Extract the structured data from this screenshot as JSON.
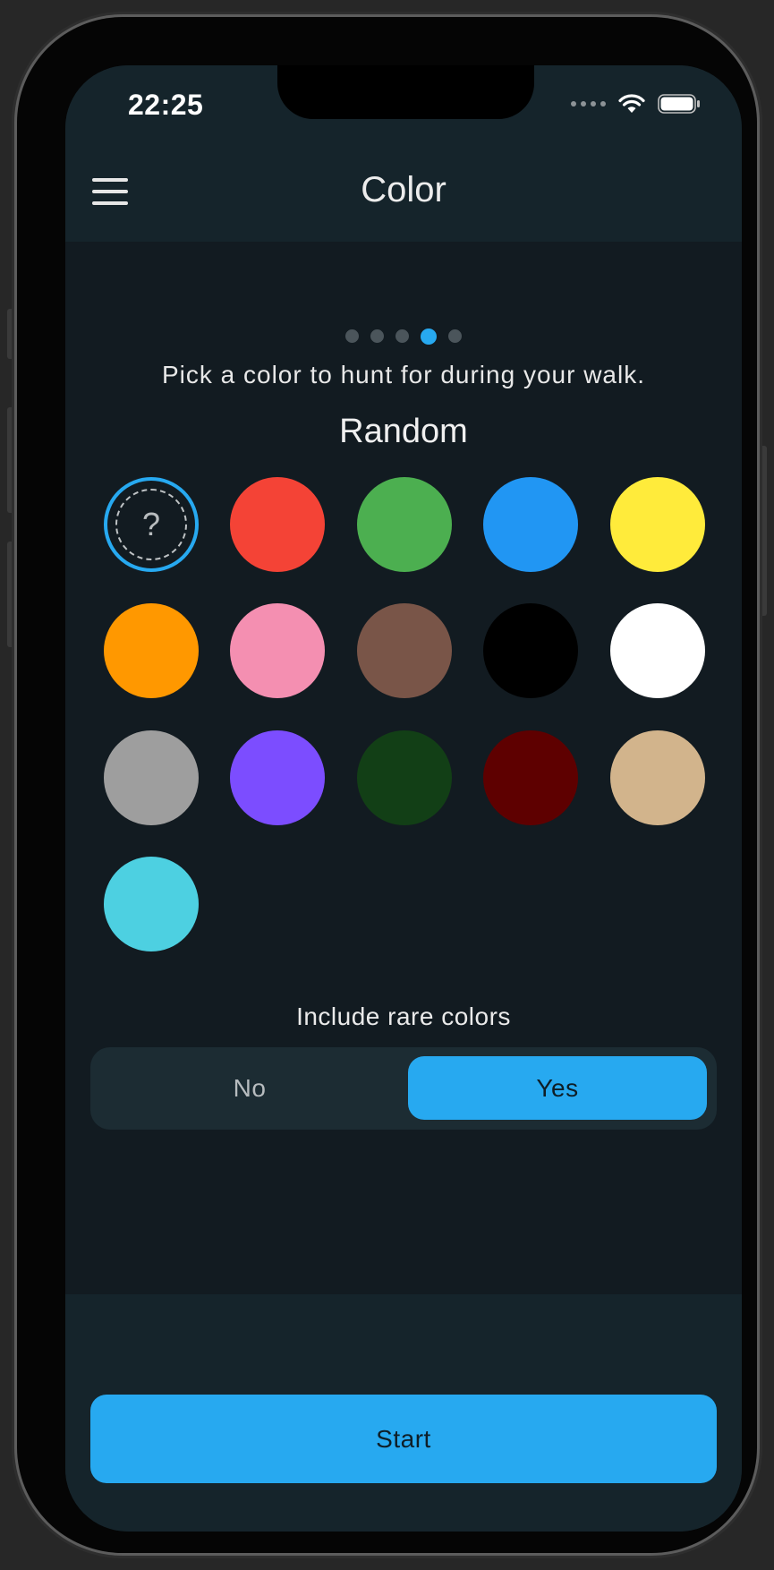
{
  "status_bar": {
    "time": "22:25"
  },
  "header": {
    "title": "Color"
  },
  "pager": {
    "total": 5,
    "active_index": 3
  },
  "main": {
    "prompt": "Pick a color to hunt for during your walk.",
    "selected_color_name": "Random",
    "random_swatch_symbol": "?",
    "swatches": [
      {
        "name": "random",
        "color": ""
      },
      {
        "name": "red",
        "color": "#f44336"
      },
      {
        "name": "green",
        "color": "#4caf50"
      },
      {
        "name": "blue",
        "color": "#2196f3"
      },
      {
        "name": "yellow",
        "color": "#ffeb3b"
      },
      {
        "name": "orange",
        "color": "#ff9800"
      },
      {
        "name": "pink",
        "color": "#f48fb1"
      },
      {
        "name": "brown",
        "color": "#795548"
      },
      {
        "name": "black",
        "color": "#000000"
      },
      {
        "name": "white",
        "color": "#ffffff"
      },
      {
        "name": "gray",
        "color": "#9e9e9e"
      },
      {
        "name": "purple",
        "color": "#7c4dff"
      },
      {
        "name": "dark-green",
        "color": "#123f16"
      },
      {
        "name": "maroon",
        "color": "#5e0000"
      },
      {
        "name": "tan",
        "color": "#d2b48c"
      },
      {
        "name": "cyan",
        "color": "#4dd0e1"
      }
    ],
    "rare_colors": {
      "label": "Include rare colors",
      "options": [
        "No",
        "Yes"
      ],
      "selected": "Yes"
    }
  },
  "footer": {
    "start_label": "Start"
  },
  "theme": {
    "accent": "#27a9f0",
    "background": "#121b21",
    "header_background": "#15242b"
  }
}
